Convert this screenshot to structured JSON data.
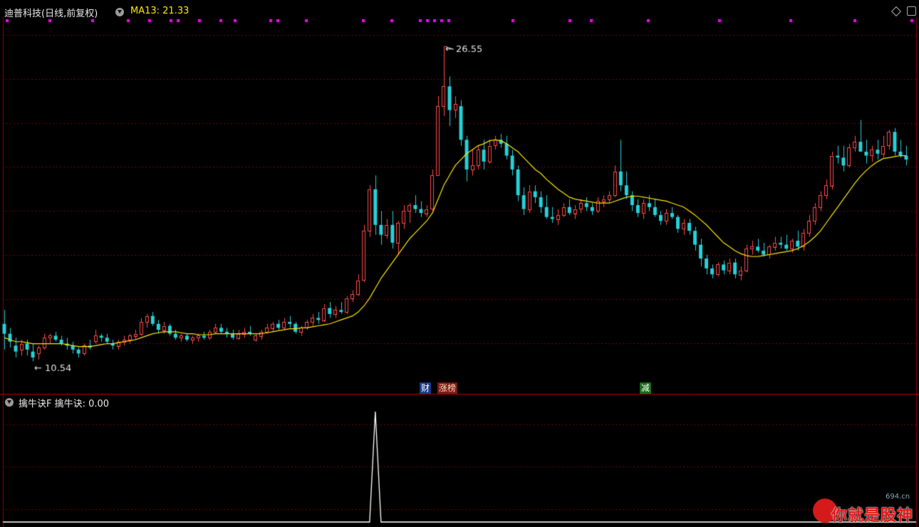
{
  "header": {
    "title": "迪普科技(日线,前复权)",
    "ma_label": "MA13: 21.33",
    "indicator_label": "擒牛诀F  擒牛诀: 0.00"
  },
  "markers": {
    "cai": "财",
    "zhangbang": "涨榜",
    "jian": "减"
  },
  "logo": {
    "text": "你就是股神",
    "site": "694.cn"
  },
  "colors": {
    "up": "#ff4a4a",
    "down": "#25d0d8",
    "ma": "#ffe600",
    "grid": "#7a0000",
    "dots": "#ff00ff",
    "indicator": "#ffffff"
  },
  "chart_data": {
    "type": "candlestick",
    "y_axis": {
      "range": [
        9.0,
        28.0
      ],
      "grid": true
    },
    "high_label": "26.55",
    "low_label": "10.54",
    "ohlc": [
      [
        12.5,
        13.2,
        11.2,
        12.0
      ],
      [
        12.0,
        12.3,
        11.3,
        11.6
      ],
      [
        11.4,
        11.8,
        10.8,
        11.1
      ],
      [
        11.2,
        11.7,
        10.9,
        11.5
      ],
      [
        11.5,
        11.7,
        10.9,
        11.2
      ],
      [
        11.1,
        11.5,
        10.6,
        10.8
      ],
      [
        11.0,
        11.4,
        10.7,
        11.3
      ],
      [
        11.3,
        12.0,
        11.2,
        11.8
      ],
      [
        11.8,
        12.0,
        11.5,
        11.9
      ],
      [
        11.9,
        12.1,
        11.6,
        11.7
      ],
      [
        11.7,
        11.9,
        11.4,
        11.5
      ],
      [
        11.5,
        11.8,
        11.2,
        11.4
      ],
      [
        11.4,
        11.6,
        11.0,
        11.2
      ],
      [
        11.2,
        11.3,
        10.8,
        11.0
      ],
      [
        11.0,
        11.5,
        10.9,
        11.4
      ],
      [
        11.4,
        11.7,
        11.2,
        11.3
      ],
      [
        11.6,
        12.2,
        11.5,
        11.9
      ],
      [
        11.9,
        12.0,
        11.6,
        11.8
      ],
      [
        11.8,
        12.0,
        11.5,
        11.6
      ],
      [
        11.5,
        11.7,
        11.2,
        11.4
      ],
      [
        11.4,
        11.7,
        11.2,
        11.6
      ],
      [
        11.6,
        11.9,
        11.4,
        11.7
      ],
      [
        11.7,
        12.0,
        11.5,
        11.9
      ],
      [
        11.9,
        12.2,
        11.7,
        12.0
      ],
      [
        12.0,
        12.8,
        11.9,
        12.6
      ],
      [
        12.6,
        13.0,
        12.3,
        12.9
      ],
      [
        12.9,
        13.1,
        12.4,
        12.5
      ],
      [
        12.5,
        12.7,
        12.0,
        12.2
      ],
      [
        12.2,
        12.6,
        12.0,
        12.4
      ],
      [
        12.4,
        12.5,
        11.9,
        12.0
      ],
      [
        12.0,
        12.2,
        11.7,
        11.8
      ],
      [
        11.8,
        12.0,
        11.6,
        11.9
      ],
      [
        11.9,
        12.0,
        11.6,
        11.7
      ],
      [
        11.7,
        11.9,
        11.5,
        11.8
      ],
      [
        11.8,
        12.0,
        11.6,
        11.9
      ],
      [
        11.9,
        12.1,
        11.7,
        11.8
      ],
      [
        11.8,
        12.2,
        11.7,
        12.1
      ],
      [
        12.1,
        12.5,
        12.0,
        12.3
      ],
      [
        12.3,
        12.5,
        12.0,
        12.1
      ],
      [
        12.1,
        12.3,
        11.8,
        12.0
      ],
      [
        12.0,
        12.2,
        11.7,
        11.8
      ],
      [
        11.8,
        12.2,
        11.7,
        12.0
      ],
      [
        12.0,
        12.3,
        11.8,
        12.1
      ],
      [
        12.1,
        12.4,
        11.9,
        12.0
      ],
      [
        11.7,
        12.0,
        11.6,
        11.9
      ],
      [
        11.9,
        12.2,
        11.7,
        12.1
      ],
      [
        12.1,
        12.5,
        12.0,
        12.3
      ],
      [
        12.3,
        12.6,
        12.1,
        12.5
      ],
      [
        12.5,
        12.7,
        12.2,
        12.3
      ],
      [
        12.3,
        12.8,
        12.2,
        12.6
      ],
      [
        12.6,
        12.9,
        12.3,
        12.5
      ],
      [
        12.5,
        12.6,
        12.0,
        12.1
      ],
      [
        12.1,
        12.4,
        11.9,
        12.3
      ],
      [
        12.3,
        12.7,
        12.2,
        12.6
      ],
      [
        12.6,
        13.0,
        12.4,
        12.8
      ],
      [
        12.8,
        13.1,
        12.5,
        12.7
      ],
      [
        12.7,
        13.5,
        12.6,
        13.3
      ],
      [
        13.3,
        13.6,
        12.8,
        13.0
      ],
      [
        13.0,
        13.4,
        12.8,
        13.2
      ],
      [
        13.2,
        13.6,
        13.0,
        13.1
      ],
      [
        13.1,
        13.9,
        13.0,
        13.8
      ],
      [
        13.8,
        14.2,
        13.6,
        14.0
      ],
      [
        14.0,
        15.0,
        13.9,
        14.7
      ],
      [
        14.7,
        17.5,
        14.6,
        17.2
      ],
      [
        17.2,
        19.5,
        16.9,
        19.3
      ],
      [
        19.3,
        20.0,
        17.0,
        17.5
      ],
      [
        17.5,
        18.2,
        16.5,
        17.0
      ],
      [
        17.0,
        17.8,
        16.8,
        17.5
      ],
      [
        17.5,
        18.2,
        16.3,
        16.6
      ],
      [
        16.6,
        17.7,
        16.0,
        17.6
      ],
      [
        17.6,
        18.5,
        17.3,
        18.2
      ],
      [
        18.2,
        18.6,
        17.6,
        18.5
      ],
      [
        18.5,
        19.0,
        18.1,
        18.3
      ],
      [
        18.3,
        18.7,
        17.9,
        18.1
      ],
      [
        18.1,
        18.5,
        17.9,
        18.3
      ],
      [
        18.3,
        20.3,
        18.2,
        20.0
      ],
      [
        20.0,
        24.0,
        20.0,
        23.5
      ],
      [
        23.5,
        26.55,
        23.0,
        24.5
      ],
      [
        24.5,
        25.0,
        22.5,
        23.3
      ],
      [
        23.3,
        24.0,
        22.9,
        23.6
      ],
      [
        23.5,
        23.8,
        21.5,
        21.8
      ],
      [
        21.8,
        22.0,
        19.7,
        20.3
      ],
      [
        20.3,
        21.3,
        20.0,
        20.5
      ],
      [
        20.5,
        21.5,
        20.3,
        21.3
      ],
      [
        21.3,
        21.8,
        20.3,
        20.7
      ],
      [
        20.7,
        21.8,
        20.6,
        21.5
      ],
      [
        21.5,
        22.0,
        21.3,
        21.8
      ],
      [
        21.8,
        22.1,
        21.4,
        21.6
      ],
      [
        21.6,
        22.0,
        20.8,
        21.0
      ],
      [
        21.0,
        21.3,
        20.0,
        20.3
      ],
      [
        20.3,
        20.5,
        18.7,
        19.0
      ],
      [
        19.0,
        19.4,
        18.0,
        18.3
      ],
      [
        18.3,
        19.5,
        18.1,
        19.2
      ],
      [
        19.2,
        19.5,
        18.6,
        18.9
      ],
      [
        18.9,
        19.2,
        18.1,
        18.4
      ],
      [
        18.4,
        19.0,
        17.8,
        17.9
      ],
      [
        17.9,
        18.4,
        17.6,
        17.8
      ],
      [
        17.8,
        18.3,
        17.5,
        18.0
      ],
      [
        18.0,
        18.6,
        17.9,
        18.4
      ],
      [
        18.4,
        18.8,
        18.0,
        18.1
      ],
      [
        18.1,
        18.5,
        17.8,
        18.3
      ],
      [
        18.3,
        18.8,
        18.1,
        18.6
      ],
      [
        18.6,
        18.9,
        18.2,
        18.4
      ],
      [
        18.4,
        18.6,
        18.0,
        18.2
      ],
      [
        18.2,
        18.9,
        18.1,
        18.7
      ],
      [
        18.7,
        19.0,
        18.4,
        18.8
      ],
      [
        18.8,
        19.2,
        18.6,
        19.0
      ],
      [
        19.0,
        20.5,
        18.9,
        20.2
      ],
      [
        20.2,
        21.8,
        19.2,
        19.5
      ],
      [
        19.5,
        20.2,
        18.8,
        19.0
      ],
      [
        19.0,
        19.2,
        18.2,
        18.5
      ],
      [
        18.5,
        18.8,
        17.9,
        18.1
      ],
      [
        18.1,
        18.8,
        17.8,
        18.6
      ],
      [
        18.6,
        19.0,
        18.2,
        18.4
      ],
      [
        18.4,
        18.8,
        17.9,
        18.0
      ],
      [
        18.0,
        18.2,
        17.5,
        17.7
      ],
      [
        17.7,
        18.3,
        17.5,
        18.1
      ],
      [
        18.1,
        18.4,
        17.8,
        17.9
      ],
      [
        17.9,
        18.0,
        17.1,
        17.3
      ],
      [
        17.3,
        17.8,
        17.0,
        17.6
      ],
      [
        17.6,
        17.8,
        17.0,
        17.2
      ],
      [
        17.2,
        17.4,
        16.2,
        16.5
      ],
      [
        16.5,
        16.8,
        15.4,
        15.8
      ],
      [
        15.8,
        16.0,
        15.0,
        15.3
      ],
      [
        15.3,
        15.5,
        14.8,
        15.0
      ],
      [
        15.0,
        15.6,
        14.9,
        15.5
      ],
      [
        15.5,
        15.7,
        15.0,
        15.2
      ],
      [
        15.2,
        15.8,
        15.0,
        15.6
      ],
      [
        15.6,
        15.8,
        14.8,
        15.0
      ],
      [
        15.0,
        15.4,
        14.7,
        15.2
      ],
      [
        15.2,
        16.5,
        15.1,
        16.3
      ],
      [
        16.3,
        16.7,
        16.0,
        16.4
      ],
      [
        16.4,
        16.8,
        16.1,
        16.2
      ],
      [
        16.2,
        16.6,
        15.9,
        16.0
      ],
      [
        16.0,
        16.5,
        15.8,
        16.4
      ],
      [
        16.4,
        16.9,
        16.2,
        16.6
      ],
      [
        16.6,
        16.9,
        16.3,
        16.5
      ],
      [
        16.5,
        17.0,
        16.2,
        16.3
      ],
      [
        16.3,
        16.8,
        16.1,
        16.7
      ],
      [
        16.7,
        17.2,
        16.2,
        16.4
      ],
      [
        16.4,
        17.3,
        16.2,
        17.1
      ],
      [
        17.1,
        18.0,
        16.9,
        17.7
      ],
      [
        17.7,
        18.6,
        17.5,
        18.4
      ],
      [
        18.4,
        19.2,
        18.2,
        19.0
      ],
      [
        19.0,
        19.8,
        18.8,
        19.5
      ],
      [
        19.5,
        21.2,
        19.3,
        21.0
      ],
      [
        21.0,
        21.5,
        20.6,
        20.9
      ],
      [
        20.9,
        21.5,
        20.2,
        20.5
      ],
      [
        20.5,
        21.6,
        20.4,
        21.4
      ],
      [
        21.4,
        22.0,
        21.2,
        21.7
      ],
      [
        21.7,
        22.8,
        21.5,
        21.2
      ],
      [
        21.2,
        21.8,
        20.6,
        21.0
      ],
      [
        21.0,
        21.5,
        20.7,
        21.3
      ],
      [
        21.3,
        21.8,
        20.8,
        21.1
      ],
      [
        21.1,
        22.0,
        20.9,
        21.5
      ],
      [
        21.5,
        22.3,
        21.3,
        22.2
      ],
      [
        22.2,
        22.4,
        21.0,
        21.2
      ],
      [
        21.2,
        21.8,
        20.9,
        21.0
      ],
      [
        21.0,
        21.5,
        20.5,
        20.8
      ]
    ],
    "ma13": [
      11.8,
      11.7,
      11.6,
      11.6,
      11.55,
      11.5,
      11.5,
      11.5,
      11.5,
      11.5,
      11.5,
      11.45,
      11.4,
      11.35,
      11.35,
      11.35,
      11.4,
      11.45,
      11.5,
      11.5,
      11.55,
      11.6,
      11.65,
      11.7,
      11.8,
      11.9,
      12.0,
      12.05,
      12.1,
      12.1,
      12.1,
      12.05,
      12.0,
      12.0,
      11.95,
      11.95,
      11.95,
      12.0,
      12.0,
      12.0,
      12.0,
      12.0,
      12.0,
      12.0,
      12.0,
      12.0,
      12.05,
      12.1,
      12.15,
      12.2,
      12.25,
      12.25,
      12.3,
      12.3,
      12.35,
      12.4,
      12.45,
      12.5,
      12.6,
      12.7,
      12.8,
      12.9,
      13.1,
      13.4,
      13.8,
      14.3,
      14.8,
      15.2,
      15.6,
      16.0,
      16.4,
      16.8,
      17.1,
      17.4,
      17.7,
      18.1,
      18.8,
      19.5,
      20.0,
      20.5,
      20.8,
      21.1,
      21.3,
      21.5,
      21.6,
      21.75,
      21.8,
      21.75,
      21.6,
      21.4,
      21.2,
      20.9,
      20.6,
      20.3,
      20.1,
      19.8,
      19.55,
      19.3,
      19.1,
      18.9,
      18.8,
      18.75,
      18.7,
      18.65,
      18.6,
      18.6,
      18.6,
      18.7,
      18.8,
      18.9,
      18.95,
      18.95,
      18.9,
      18.85,
      18.8,
      18.75,
      18.7,
      18.6,
      18.5,
      18.4,
      18.2,
      18.0,
      17.75,
      17.5,
      17.2,
      16.9,
      16.6,
      16.4,
      16.2,
      16.05,
      15.95,
      15.9,
      15.9,
      15.95,
      16.0,
      16.05,
      16.1,
      16.15,
      16.2,
      16.3,
      16.45,
      16.65,
      16.9,
      17.2,
      17.6,
      18.0,
      18.4,
      18.8,
      19.2,
      19.6,
      19.95,
      20.25,
      20.5,
      20.7,
      20.85,
      20.9,
      20.95,
      21.0,
      21.0
    ],
    "indicator": {
      "label": "擒牛诀",
      "value": "0.00",
      "spike_index": 65,
      "spike_value": 1.0
    }
  }
}
